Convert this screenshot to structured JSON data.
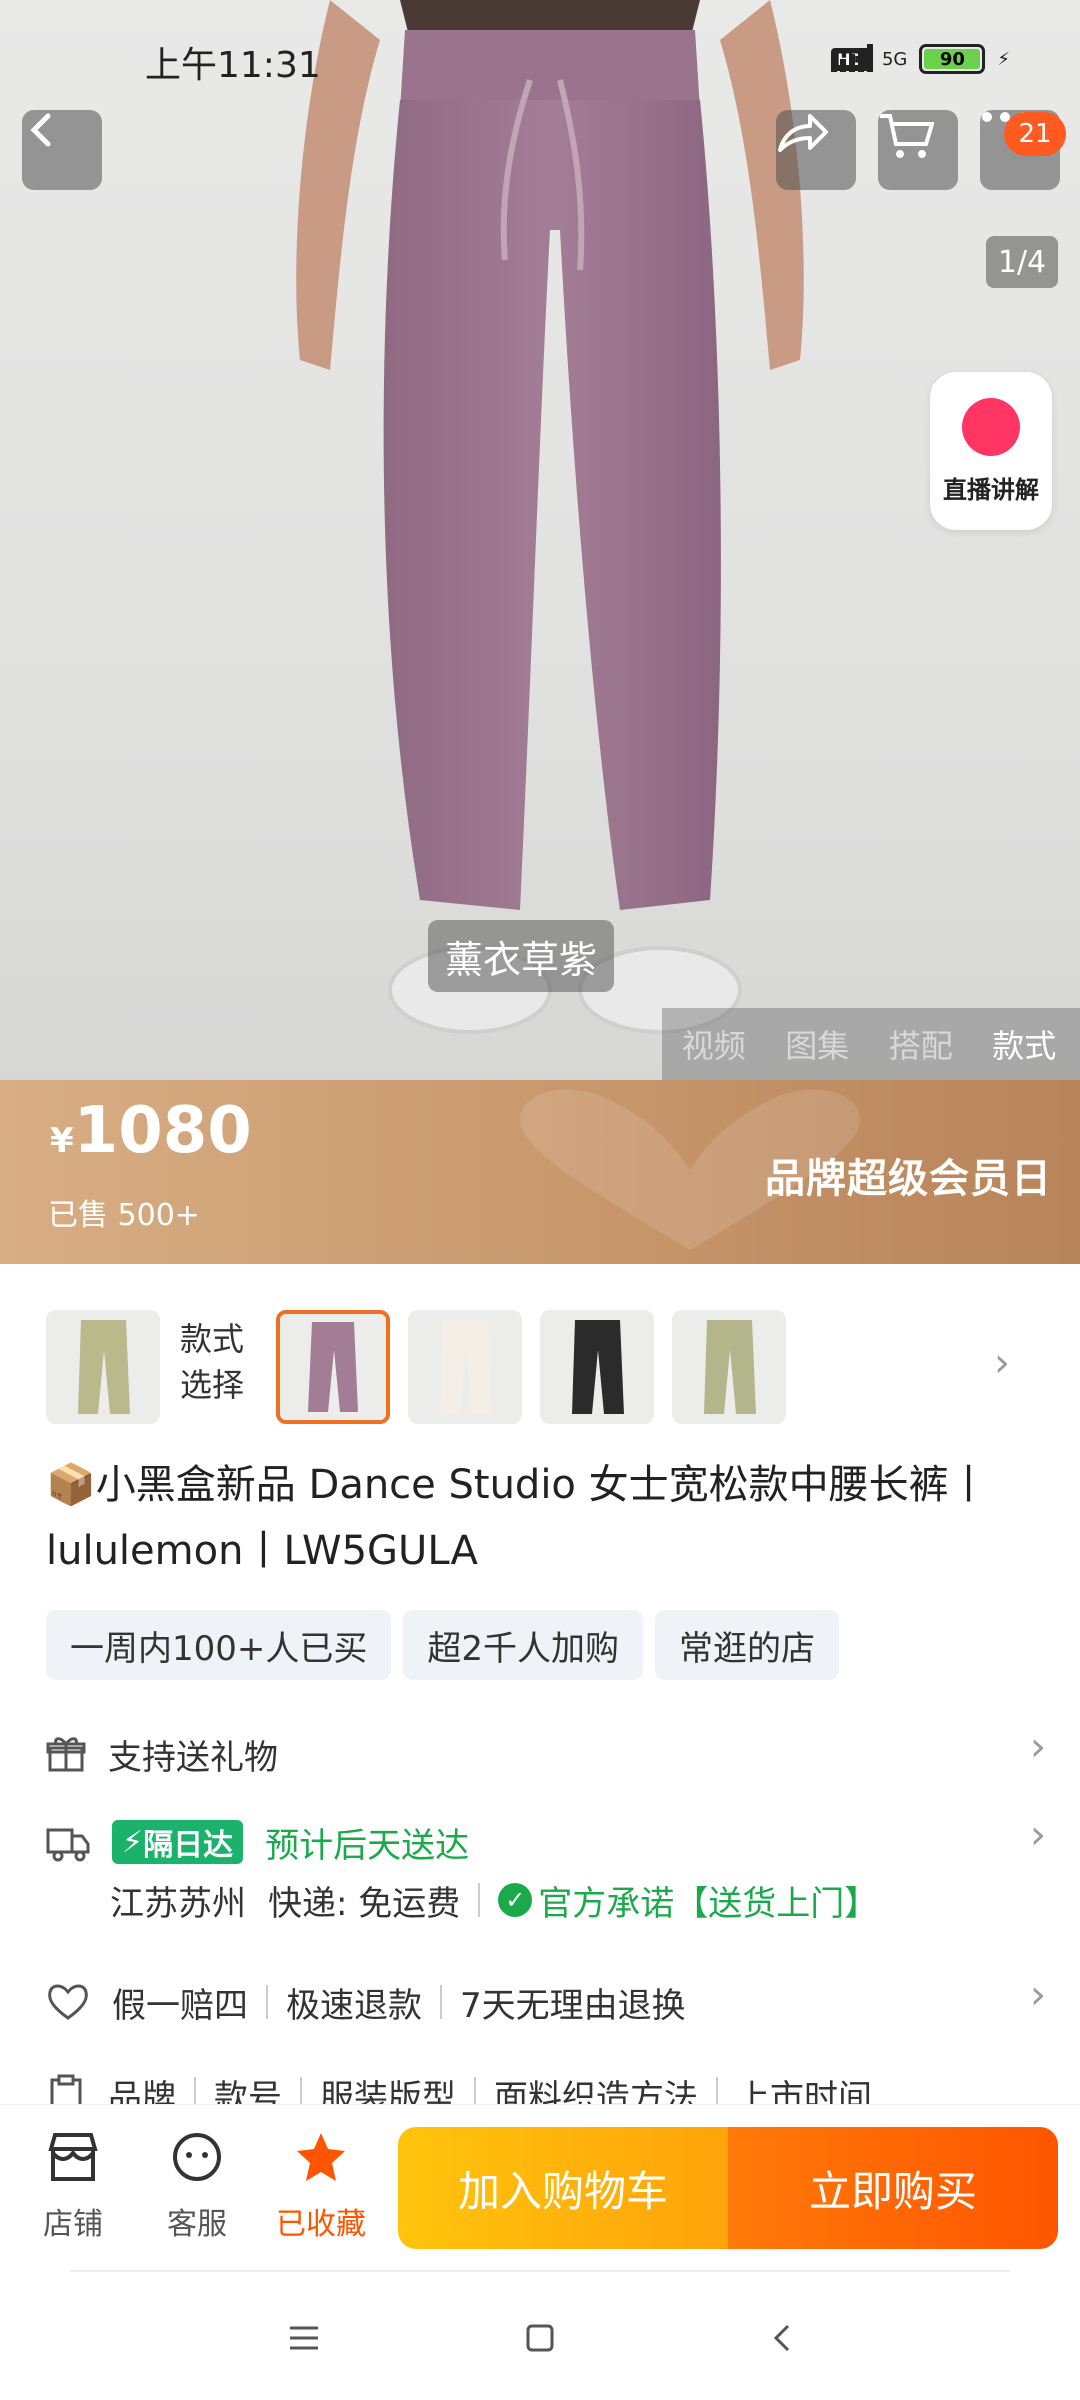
{
  "status_bar": {
    "time": "上午11:31",
    "hd": "HD",
    "network": "5G",
    "battery": "90"
  },
  "gallery": {
    "counter": "1/4",
    "live_label": "直播讲解",
    "color_name": "薰衣草紫",
    "cart_badge": "21",
    "tabs": [
      "视频",
      "图集",
      "搭配",
      "款式"
    ],
    "active_tab": "款式"
  },
  "price": {
    "currency": "¥",
    "amount": "1080",
    "sold": "已售 500+",
    "promo": "品牌超级会员日"
  },
  "options": {
    "label_line1": "款式",
    "label_line2": "选择"
  },
  "product": {
    "title": "📦小黑盒新品 Dance Studio 女士宽松款中腰长裤丨lululemon丨LW5GULA"
  },
  "tags": [
    "一周内100+人已买",
    "超2千人加购",
    "常逛的店"
  ],
  "services": {
    "gift": "支持送礼物",
    "next_day_badge": "隔日达",
    "delivery_estimate": "预计后天送达",
    "origin": "江苏苏州",
    "shipping": "快递: 免运费",
    "promise": "官方承诺【送货上门】",
    "guarantee": [
      "假一赔四",
      "极速退款",
      "7天无理由退换"
    ],
    "params": [
      "品牌",
      "款号",
      "服装版型",
      "面料织造方法",
      "上市时间"
    ]
  },
  "bottom_bar": {
    "store": "店铺",
    "service": "客服",
    "favorite": "已收藏",
    "add_to_cart": "加入购物车",
    "buy_now": "立即购买"
  },
  "colors": {
    "accent": "#ff5500",
    "cart_button": "#ffc40d",
    "green": "#1ba94c",
    "price_band": "#c8976c"
  }
}
